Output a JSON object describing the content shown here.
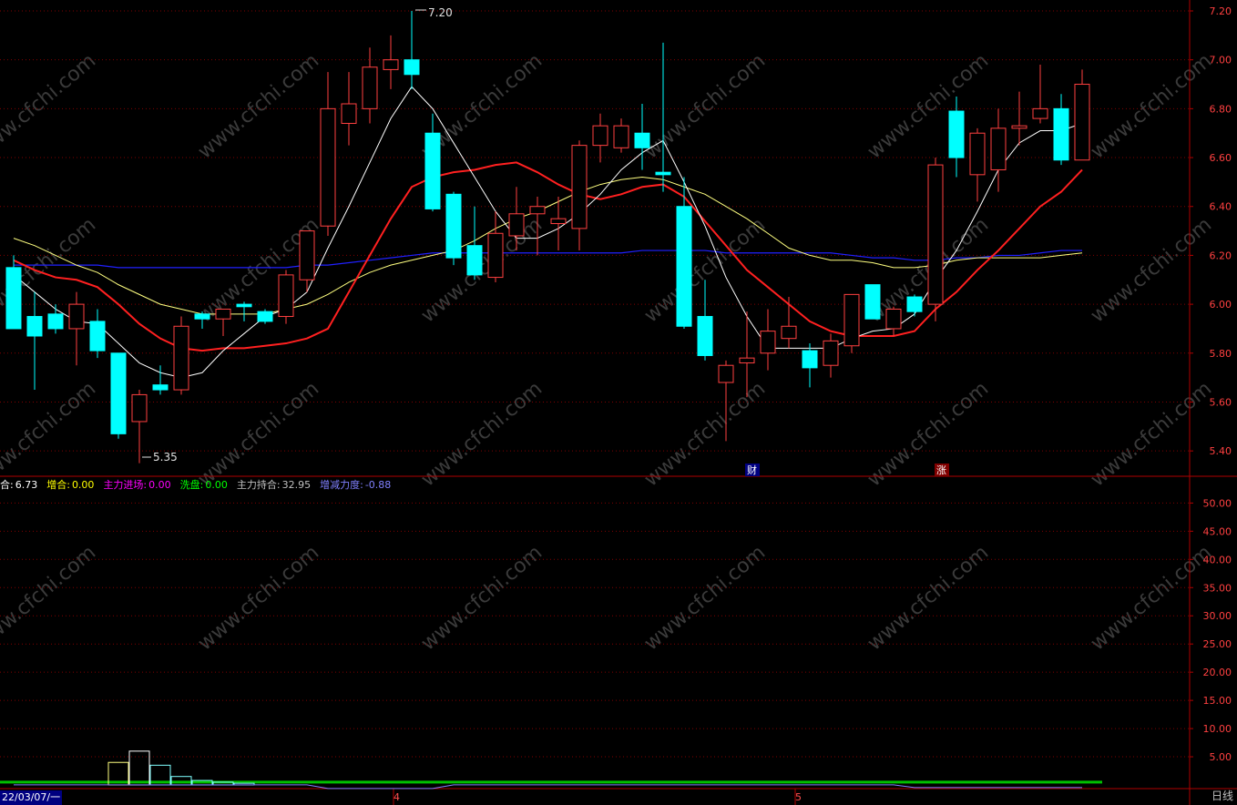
{
  "indicator": {
    "items": [
      {
        "label": "合:",
        "value": "6.73",
        "color": "#ffffff",
        "valcolor": "#ffffff"
      },
      {
        "label": "增合:",
        "value": "0.00",
        "color": "#ffff00",
        "valcolor": "#ffff00"
      },
      {
        "label": "主力进场:",
        "value": "0.00",
        "color": "#ff00ff",
        "valcolor": "#ff00ff"
      },
      {
        "label": "洗盘:",
        "value": "0.00",
        "color": "#00ff00",
        "valcolor": "#00ff00"
      },
      {
        "label": "主力持合:",
        "value": "32.95",
        "color": "#c0c0c0",
        "valcolor": "#c0c0c0"
      },
      {
        "label": "增减力度:",
        "value": "-0.88",
        "color": "#8080ff",
        "valcolor": "#8080ff"
      }
    ]
  },
  "footer": {
    "date": "22/03/07/一",
    "month_ticks": [
      "4",
      "5"
    ],
    "period": "日线"
  },
  "markers": {
    "high": "7.20",
    "low": "5.35",
    "cai": "财",
    "zhang": "涨"
  },
  "watermark": "www.cfchi.com",
  "colors": {
    "up": "#ff4040",
    "down": "#00ffff",
    "ma5": "#ffffff",
    "ma10": "#ff2020",
    "ma20": "#ffff80",
    "ma60": "#2020ff",
    "grid": "#800000",
    "axis": "#b00000"
  },
  "chart_data": [
    {
      "type": "candlestick",
      "ylim": [
        5.3,
        7.2
      ],
      "yticks": [
        5.4,
        5.6,
        5.8,
        6.0,
        6.2,
        6.4,
        6.6,
        6.8,
        7.0,
        7.2
      ],
      "candles": [
        {
          "o": 6.15,
          "h": 6.2,
          "l": 5.95,
          "c": 5.9
        },
        {
          "o": 5.95,
          "h": 6.05,
          "l": 5.65,
          "c": 5.87
        },
        {
          "o": 5.96,
          "h": 6.0,
          "l": 5.88,
          "c": 5.9
        },
        {
          "o": 5.9,
          "h": 6.05,
          "l": 5.75,
          "c": 6.0
        },
        {
          "o": 5.93,
          "h": 5.98,
          "l": 5.78,
          "c": 5.81
        },
        {
          "o": 5.8,
          "h": 5.8,
          "l": 5.45,
          "c": 5.47
        },
        {
          "o": 5.52,
          "h": 5.65,
          "l": 5.35,
          "c": 5.63
        },
        {
          "o": 5.67,
          "h": 5.75,
          "l": 5.63,
          "c": 5.65
        },
        {
          "o": 5.65,
          "h": 5.95,
          "l": 5.63,
          "c": 5.91
        },
        {
          "o": 5.96,
          "h": 5.97,
          "l": 5.9,
          "c": 5.94
        },
        {
          "o": 5.94,
          "h": 5.98,
          "l": 5.87,
          "c": 5.98
        },
        {
          "o": 6.0,
          "h": 6.01,
          "l": 5.93,
          "c": 5.99
        },
        {
          "o": 5.97,
          "h": 5.98,
          "l": 5.92,
          "c": 5.93
        },
        {
          "o": 5.95,
          "h": 6.14,
          "l": 5.92,
          "c": 6.12
        },
        {
          "o": 6.1,
          "h": 6.2,
          "l": 6.05,
          "c": 6.3
        },
        {
          "o": 6.32,
          "h": 6.95,
          "l": 6.28,
          "c": 6.8
        },
        {
          "o": 6.74,
          "h": 6.95,
          "l": 6.65,
          "c": 6.82
        },
        {
          "o": 6.8,
          "h": 7.05,
          "l": 6.74,
          "c": 6.97
        },
        {
          "o": 6.96,
          "h": 7.1,
          "l": 6.88,
          "c": 7.0
        },
        {
          "o": 7.0,
          "h": 7.2,
          "l": 6.88,
          "c": 6.94
        },
        {
          "o": 6.7,
          "h": 6.78,
          "l": 6.38,
          "c": 6.39
        },
        {
          "o": 6.45,
          "h": 6.46,
          "l": 6.16,
          "c": 6.19
        },
        {
          "o": 6.24,
          "h": 6.4,
          "l": 6.1,
          "c": 6.12
        },
        {
          "o": 6.11,
          "h": 6.38,
          "l": 6.09,
          "c": 6.29
        },
        {
          "o": 6.28,
          "h": 6.48,
          "l": 6.22,
          "c": 6.37
        },
        {
          "o": 6.37,
          "h": 6.44,
          "l": 6.2,
          "c": 6.4
        },
        {
          "o": 6.33,
          "h": 6.44,
          "l": 6.22,
          "c": 6.35
        },
        {
          "o": 6.31,
          "h": 6.67,
          "l": 6.22,
          "c": 6.65
        },
        {
          "o": 6.65,
          "h": 6.78,
          "l": 6.58,
          "c": 6.73
        },
        {
          "o": 6.64,
          "h": 6.76,
          "l": 6.62,
          "c": 6.73
        },
        {
          "o": 6.7,
          "h": 6.82,
          "l": 6.55,
          "c": 6.64
        },
        {
          "o": 6.54,
          "h": 7.07,
          "l": 6.46,
          "c": 6.53
        },
        {
          "o": 6.4,
          "h": 6.52,
          "l": 5.9,
          "c": 5.91
        },
        {
          "o": 5.95,
          "h": 6.1,
          "l": 5.77,
          "c": 5.79
        },
        {
          "o": 5.68,
          "h": 5.77,
          "l": 5.44,
          "c": 5.75
        },
        {
          "o": 5.76,
          "h": 5.97,
          "l": 5.62,
          "c": 5.78
        },
        {
          "o": 5.8,
          "h": 5.98,
          "l": 5.73,
          "c": 5.89
        },
        {
          "o": 5.86,
          "h": 6.03,
          "l": 5.82,
          "c": 5.91
        },
        {
          "o": 5.81,
          "h": 5.84,
          "l": 5.66,
          "c": 5.74
        },
        {
          "o": 5.75,
          "h": 5.88,
          "l": 5.7,
          "c": 5.85
        },
        {
          "o": 5.83,
          "h": 6.04,
          "l": 5.8,
          "c": 6.04
        },
        {
          "o": 6.08,
          "h": 6.08,
          "l": 5.94,
          "c": 5.94
        },
        {
          "o": 5.9,
          "h": 5.99,
          "l": 5.87,
          "c": 5.98
        },
        {
          "o": 6.03,
          "h": 6.04,
          "l": 5.95,
          "c": 5.97
        },
        {
          "o": 6.0,
          "h": 6.6,
          "l": 5.93,
          "c": 6.57
        },
        {
          "o": 6.79,
          "h": 6.85,
          "l": 6.52,
          "c": 6.6
        },
        {
          "o": 6.53,
          "h": 6.72,
          "l": 6.42,
          "c": 6.7
        },
        {
          "o": 6.55,
          "h": 6.8,
          "l": 6.46,
          "c": 6.72
        },
        {
          "o": 6.72,
          "h": 6.87,
          "l": 6.65,
          "c": 6.73
        },
        {
          "o": 6.76,
          "h": 6.98,
          "l": 6.74,
          "c": 6.8
        },
        {
          "o": 6.8,
          "h": 6.86,
          "l": 6.57,
          "c": 6.59
        },
        {
          "o": 6.59,
          "h": 6.96,
          "l": 6.59,
          "c": 6.9
        }
      ],
      "ma5": [
        6.12,
        6.05,
        5.98,
        5.93,
        5.92,
        5.84,
        5.76,
        5.72,
        5.7,
        5.72,
        5.81,
        5.88,
        5.95,
        5.98,
        6.05,
        6.23,
        6.4,
        6.58,
        6.76,
        6.89,
        6.8,
        6.66,
        6.52,
        6.38,
        6.27,
        6.27,
        6.31,
        6.37,
        6.45,
        6.55,
        6.62,
        6.67,
        6.5,
        6.32,
        6.11,
        5.95,
        5.82,
        5.82,
        5.82,
        5.82,
        5.86,
        5.89,
        5.9,
        5.96,
        6.1,
        6.22,
        6.38,
        6.55,
        6.66,
        6.71,
        6.71,
        6.74
      ],
      "ma10": [
        6.18,
        6.14,
        6.11,
        6.1,
        6.07,
        6.0,
        5.92,
        5.86,
        5.82,
        5.81,
        5.82,
        5.82,
        5.83,
        5.84,
        5.86,
        5.9,
        6.05,
        6.2,
        6.35,
        6.48,
        6.52,
        6.54,
        6.55,
        6.57,
        6.58,
        6.54,
        6.49,
        6.45,
        6.43,
        6.45,
        6.48,
        6.49,
        6.44,
        6.34,
        6.24,
        6.14,
        6.07,
        6.0,
        5.93,
        5.89,
        5.87,
        5.87,
        5.87,
        5.89,
        5.98,
        6.05,
        6.14,
        6.22,
        6.31,
        6.4,
        6.46,
        6.55
      ],
      "ma20": [
        6.27,
        6.24,
        6.2,
        6.16,
        6.13,
        6.08,
        6.04,
        6.0,
        5.98,
        5.96,
        5.96,
        5.96,
        5.96,
        5.98,
        6.0,
        6.04,
        6.09,
        6.13,
        6.16,
        6.18,
        6.2,
        6.22,
        6.26,
        6.31,
        6.35,
        6.38,
        6.42,
        6.46,
        6.49,
        6.51,
        6.52,
        6.51,
        6.48,
        6.45,
        6.4,
        6.35,
        6.29,
        6.23,
        6.2,
        6.18,
        6.18,
        6.17,
        6.15,
        6.15,
        6.16,
        6.18,
        6.19,
        6.19,
        6.19,
        6.19,
        6.2,
        6.21
      ],
      "ma60": [
        6.16,
        6.16,
        6.16,
        6.16,
        6.16,
        6.15,
        6.15,
        6.15,
        6.15,
        6.15,
        6.15,
        6.15,
        6.15,
        6.15,
        6.16,
        6.16,
        6.17,
        6.18,
        6.19,
        6.2,
        6.21,
        6.21,
        6.21,
        6.21,
        6.21,
        6.21,
        6.21,
        6.21,
        6.21,
        6.21,
        6.22,
        6.22,
        6.22,
        6.22,
        6.21,
        6.21,
        6.21,
        6.21,
        6.21,
        6.21,
        6.2,
        6.19,
        6.19,
        6.18,
        6.18,
        6.19,
        6.19,
        6.2,
        6.2,
        6.21,
        6.22,
        6.22
      ]
    },
    {
      "type": "bar",
      "ylim": [
        0,
        52
      ],
      "yticks": [
        5,
        10,
        15,
        20,
        25,
        30,
        35,
        40,
        45,
        50
      ],
      "labels": [
        "5.00",
        "10.00",
        "15.00",
        "20.00",
        "25.00",
        "30.00",
        "35.00",
        "40.00",
        "45.00",
        "50.00"
      ],
      "series": [
        {
          "values": [
            0,
            0,
            0,
            0,
            0,
            4,
            6,
            3.5,
            1.5,
            0.8,
            0.5,
            0.3,
            0.2,
            0.2,
            0.1,
            0.1,
            0.1,
            0.1,
            0.1,
            0.1,
            0.1,
            0.1,
            0.1,
            0.1,
            0.1,
            0.1,
            0.1,
            0.1,
            0.1,
            0.1,
            0.1,
            0.1,
            0.1,
            0.1,
            0.1,
            0.1,
            0.1,
            0.1,
            0.1,
            0.1,
            0.1,
            0.1,
            0.1,
            0.1,
            0.1,
            0.1,
            0.1,
            0.1,
            0.1,
            0.1,
            0.1,
            0.1
          ]
        }
      ],
      "baseline": 0.5
    }
  ]
}
